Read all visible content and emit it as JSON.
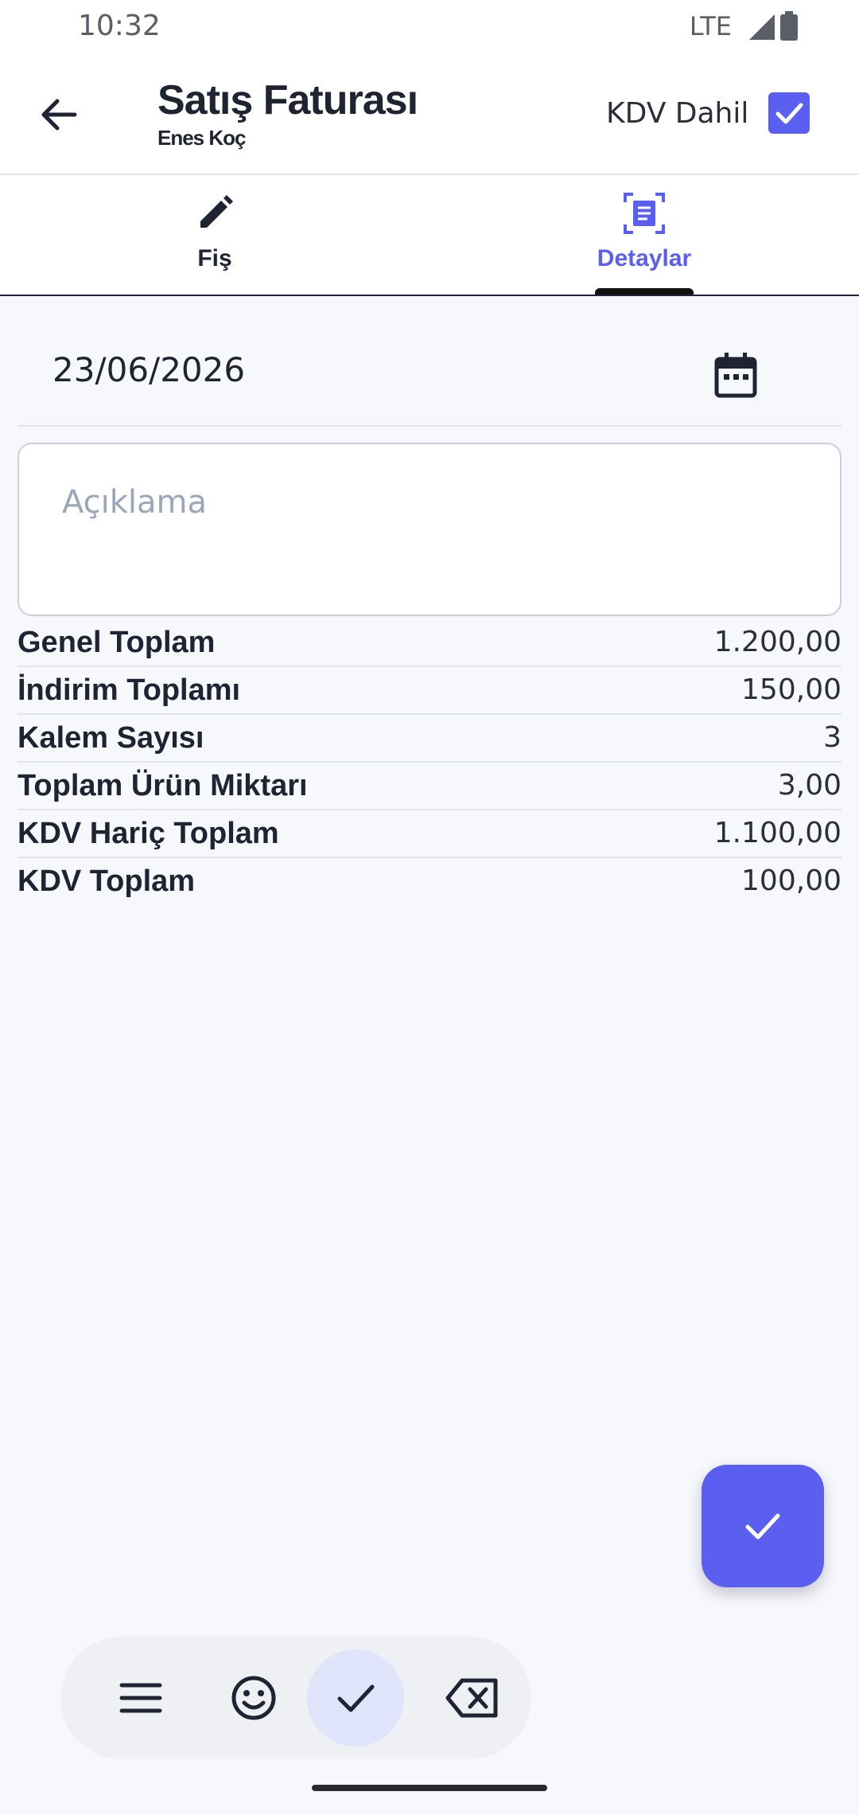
{
  "status_bar": {
    "time": "10:32",
    "network": "LTE",
    "icons": [
      "signal-icon",
      "battery-icon"
    ]
  },
  "app_bar": {
    "title": "Satış Faturası",
    "subtitle": "Enes Koç",
    "kdv_label": "KDV Dahil",
    "kdv_checked": true,
    "back_icon": "arrow-left-icon"
  },
  "tabs": [
    {
      "label": "Fiş",
      "icon": "pencil-icon",
      "active": false
    },
    {
      "label": "Detaylar",
      "icon": "document-scan-icon",
      "active": true
    }
  ],
  "form": {
    "date_value": "23/06/2026",
    "calendar_icon": "calendar-icon",
    "description_placeholder": "Açıklama",
    "description_value": ""
  },
  "summary": [
    {
      "label": "Genel Toplam",
      "value": "1.200,00"
    },
    {
      "label": "İndirim Toplamı",
      "value": "150,00"
    },
    {
      "label": "Kalem Sayısı",
      "value": "3"
    },
    {
      "label": "Toplam Ürün Miktarı",
      "value": "3,00"
    },
    {
      "label": "KDV Hariç Toplam",
      "value": "1.100,00"
    },
    {
      "label": "KDV Toplam",
      "value": "100,00"
    }
  ],
  "fab": {
    "icon": "check-icon"
  },
  "keyboard_toolbar": {
    "buttons": [
      "menu-icon",
      "emoji-icon",
      "check-icon",
      "backspace-icon"
    ]
  },
  "colors": {
    "accent": "#5b5ff0",
    "text": "#1f2433",
    "background": "#f7f8fb",
    "placeholder": "#9aa7ba"
  }
}
